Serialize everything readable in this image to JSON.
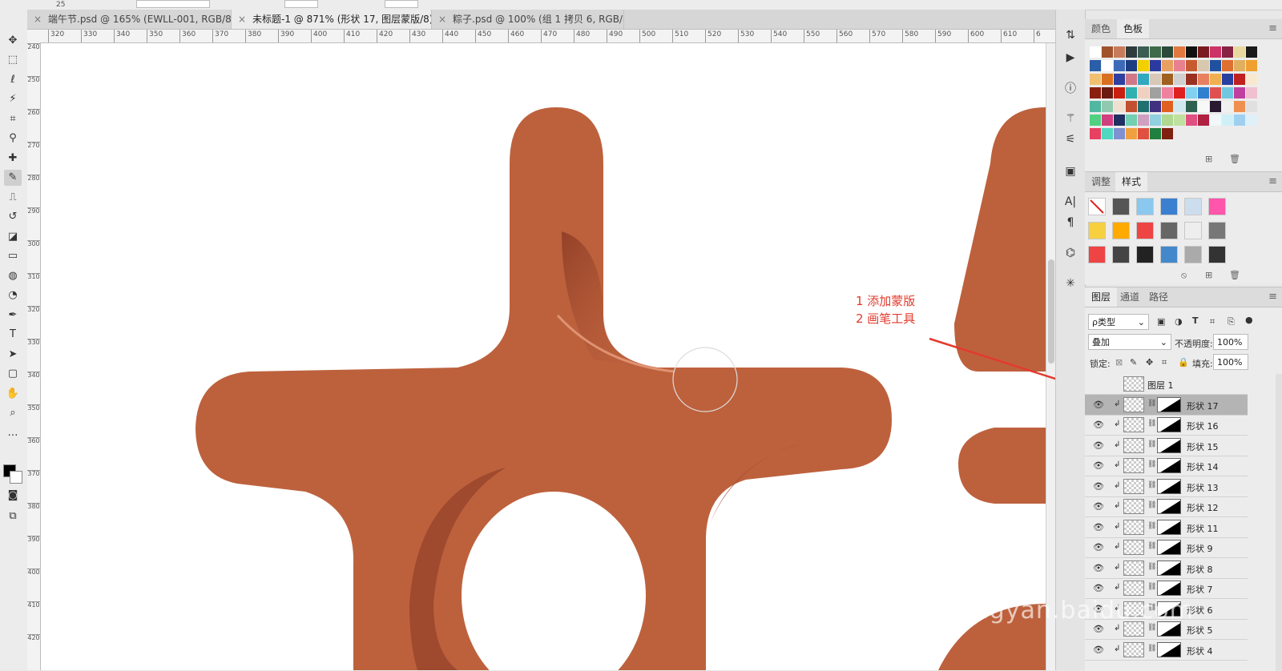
{
  "options_bar": {
    "value": "25"
  },
  "tabs": [
    {
      "label": "端午节.psd @ 165% (EWLL-001, RGB/8) *",
      "close": "×"
    },
    {
      "label": "未标题-1 @ 871% (形状 17, 图层蒙版/8) *",
      "close": "×"
    },
    {
      "label": "粽子.psd @ 100% (组 1 拷贝 6, RGB/8)",
      "close": "×"
    }
  ],
  "ruler_top": [
    "320",
    "330",
    "340",
    "350",
    "360",
    "370",
    "380",
    "390",
    "400",
    "410",
    "420",
    "430",
    "440",
    "450",
    "460",
    "470",
    "480",
    "490",
    "500",
    "510",
    "520",
    "530",
    "540",
    "550",
    "560",
    "570",
    "580",
    "590",
    "600",
    "610",
    "6"
  ],
  "ruler_left": [
    "240",
    "250",
    "260",
    "270",
    "280",
    "290",
    "300",
    "310",
    "320",
    "330",
    "340",
    "350",
    "360",
    "370",
    "380",
    "390",
    "400",
    "410",
    "420"
  ],
  "tools": [
    "move-tool",
    "marquee-tool",
    "lasso-tool",
    "magic-wand-tool",
    "crop-tool",
    "eyedropper-tool",
    "healing-tool",
    "brush-tool",
    "stamp-tool",
    "history-brush-tool",
    "eraser-tool",
    "gradient-tool",
    "blur-tool",
    "dodge-tool",
    "pen-tool",
    "type-tool",
    "path-select-tool",
    "rectangle-tool",
    "hand-tool",
    "zoom-tool",
    "more-tools"
  ],
  "swatches_panel": {
    "tabs": [
      "颜色",
      "色板"
    ],
    "active_tab": "色板",
    "colors": [
      "#ffffff",
      "#a0522d",
      "#c87b5a",
      "#2f3a3c",
      "#3a5e52",
      "#3f6b4a",
      "#2c4a3a",
      "#e07840",
      "#111111",
      "#7a1a20",
      "#cc3366",
      "#882244",
      "#e8d8a0",
      "#1a1a1a",
      "#2a5ea8",
      "#ffffff",
      "#3b6bb8",
      "#1e3c80",
      "#f2d000",
      "#2a3aa0",
      "#e8a060",
      "#e88090",
      "#c85a30",
      "#d8c8b0",
      "#2050a0",
      "#e07030",
      "#e0b060",
      "#f0a030",
      "#f0c070",
      "#d87020",
      "#3040a0",
      "#d07888",
      "#30a8c0",
      "#d8c8b8",
      "#a06020",
      "#d0d0d0",
      "#9a3020",
      "#e88060",
      "#f0b050",
      "#2840a0",
      "#c02020",
      "#f8e8d0",
      "#8a2010",
      "#6a1a10",
      "#c82010",
      "#30b0b0",
      "#f0d0c0",
      "#a0a0a0",
      "#f080a0",
      "#e02020",
      "#80d0f0",
      "#3080d0",
      "#e05050",
      "#70c8e0",
      "#c040a0",
      "#f0c0d0",
      "#50b8a0",
      "#90c8b0",
      "#f0e0d0",
      "#c05030",
      "#207070",
      "#403080",
      "#e06020",
      "#d0e8f0",
      "#306050",
      "#f8f8f8",
      "#2a1a30",
      "#f0f0f0",
      "#f09050",
      "#e0e0e0",
      "#50d080",
      "#d04080",
      "#203060",
      "#70d0b0",
      "#d0a0c0",
      "#90d0e0",
      "#b0d890",
      "#c0e0a0",
      "#e05080",
      "#b02040",
      "#f0f8f8",
      "#d0f0f8",
      "#a0d0f0",
      "#e0f0f8",
      "#e84060",
      "#50d8c0",
      "#8090d0",
      "#f0a040",
      "#e05040",
      "#208040",
      "#802010"
    ]
  },
  "styles_panel": {
    "tabs": [
      "调整",
      "样式"
    ],
    "active_tab": "样式"
  },
  "layers_panel": {
    "tabs": [
      "图层",
      "通道",
      "路径"
    ],
    "active_tab": "图层",
    "filter": "ρ类型",
    "blend_mode": "叠加",
    "opacity_label": "不透明度:",
    "opacity": "100%",
    "lock_label": "锁定:",
    "fill_label": "填充:",
    "fill": "100%",
    "layers": [
      {
        "name": "图层 1",
        "visible": false,
        "clipped": false,
        "mask": false,
        "active": false
      },
      {
        "name": "形状 17",
        "visible": true,
        "clipped": true,
        "mask": true,
        "active": true
      },
      {
        "name": "形状 16",
        "visible": true,
        "clipped": true,
        "mask": true,
        "active": false
      },
      {
        "name": "形状 15",
        "visible": true,
        "clipped": true,
        "mask": true,
        "active": false
      },
      {
        "name": "形状 14",
        "visible": true,
        "clipped": true,
        "mask": true,
        "active": false
      },
      {
        "name": "形状 13",
        "visible": true,
        "clipped": true,
        "mask": true,
        "active": false
      },
      {
        "name": "形状 12",
        "visible": true,
        "clipped": true,
        "mask": true,
        "active": false
      },
      {
        "name": "形状 11",
        "visible": true,
        "clipped": true,
        "mask": true,
        "active": false
      },
      {
        "name": "形状 9",
        "visible": true,
        "clipped": true,
        "mask": true,
        "active": false
      },
      {
        "name": "形状 8",
        "visible": true,
        "clipped": true,
        "mask": true,
        "active": false
      },
      {
        "name": "形状 7",
        "visible": true,
        "clipped": true,
        "mask": true,
        "active": false
      },
      {
        "name": "形状 6",
        "visible": true,
        "clipped": true,
        "mask": true,
        "active": false
      },
      {
        "name": "形状 5",
        "visible": true,
        "clipped": true,
        "mask": true,
        "active": false
      },
      {
        "name": "形状 4",
        "visible": true,
        "clipped": true,
        "mask": true,
        "active": false
      }
    ]
  },
  "annotation": {
    "line1": "1 添加蒙版",
    "line2": "2 画笔工具",
    "color": "#e23b2e"
  },
  "watermark": "jingyan.baidu.com",
  "colors": {
    "shape": "#bd613d",
    "shape_dark": "#94412a",
    "highlight": "#d88a66"
  }
}
